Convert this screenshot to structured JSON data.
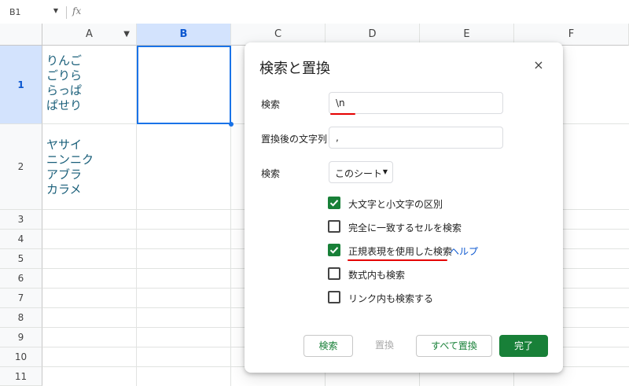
{
  "formula_bar": {
    "name_box": "B1",
    "fx": "fx"
  },
  "columns": [
    "A",
    "B",
    "C",
    "D",
    "E",
    "F"
  ],
  "rows": [
    "1",
    "2",
    "3",
    "4",
    "5",
    "6",
    "7",
    "8",
    "9",
    "10",
    "11"
  ],
  "cells": {
    "A1": "りんご\nごりら\nらっぱ\nぱせり",
    "A2": "ヤサイ\nニンニク\nアブラ\nカラメ"
  },
  "dialog": {
    "title": "検索と置換",
    "close": "×",
    "search_label": "検索",
    "search_value": "\\n",
    "replace_label": "置換後の文字列",
    "replace_value": ",",
    "scope_label": "検索",
    "scope_value": "このシート",
    "options": [
      {
        "label": "大文字と小文字の区別",
        "checked": true
      },
      {
        "label": "完全に一致するセルを検索",
        "checked": false
      },
      {
        "label": "正規表現を使用した検索",
        "checked": true
      },
      {
        "label": "数式内も検索",
        "checked": false
      },
      {
        "label": "リンク内も検索する",
        "checked": false
      }
    ],
    "help_link": "ヘルプ",
    "buttons": {
      "find": "検索",
      "replace": "置換",
      "replace_all": "すべて置換",
      "done": "完了"
    }
  },
  "colors": {
    "accent": "#188038",
    "selection": "#1a73e8",
    "cell_text": "#1a5f7a",
    "annotation": "#e50000"
  }
}
